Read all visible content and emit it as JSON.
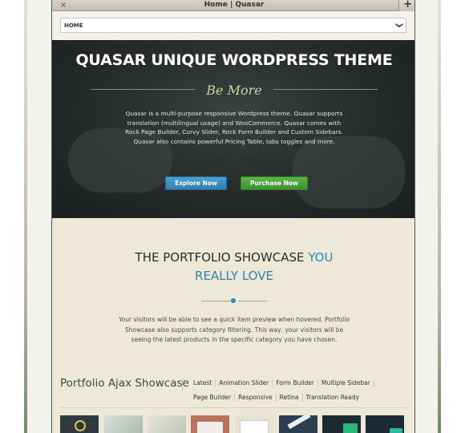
{
  "browser": {
    "close_glyph": "×",
    "tab_title": "Home | Quasar",
    "new_tab_glyph": "+"
  },
  "nav": {
    "selected": "HOME",
    "chevron_glyph": "❯"
  },
  "hero": {
    "title": "QUASAR UNIQUE WORDPRESS THEME",
    "subtitle": "Be More",
    "description": "Quasar is a multi-purpose responsive Wordpress theme. Quasar supports translation (multilingual usage) and WooCommerce. Quasar comes with Rock Page Builder, Curvy Slider, Rock Form Builder and Custom Sidebars. Quasar also contains powerful Pricing Table, tabs toggles and more.",
    "explore_label": "Explore Now",
    "purchase_label": "Purchase Now"
  },
  "portfolio": {
    "heading_main": "THE PORTFOLIO SHOWCASE",
    "heading_highlight_1": "YOU",
    "heading_highlight_2": "REALLY LOVE",
    "description": "Your visitors will be able to see a quick item preview when hovered. Portfolio Showcase also supports category filtering. This way, your visitors will be seeing the latest products in the specific category you have chosen."
  },
  "ajax": {
    "title": "Portfolio Ajax Showcase",
    "filters_row1": [
      "Latest",
      "Animation Slider",
      "Form Builder",
      "Multiple Sidebar"
    ],
    "filters_row2": [
      "Page Builder",
      "Responsive",
      "Retina",
      "Translation Ready"
    ]
  },
  "colors": {
    "accent_blue": "#2a86b5",
    "explore_button": "#3a8fc0",
    "purchase_button": "#4ea33d",
    "page_background": "#eee8d8",
    "hero_background": "#262b2a"
  }
}
